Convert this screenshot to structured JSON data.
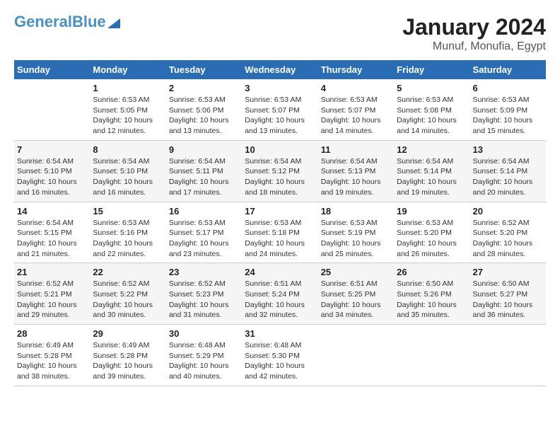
{
  "logo": {
    "part1": "General",
    "part2": "Blue"
  },
  "title": "January 2024",
  "subtitle": "Munuf, Monufia, Egypt",
  "days_of_week": [
    "Sunday",
    "Monday",
    "Tuesday",
    "Wednesday",
    "Thursday",
    "Friday",
    "Saturday"
  ],
  "weeks": [
    [
      {
        "num": "",
        "sunrise": "",
        "sunset": "",
        "daylight": ""
      },
      {
        "num": "1",
        "sunrise": "Sunrise: 6:53 AM",
        "sunset": "Sunset: 5:05 PM",
        "daylight": "Daylight: 10 hours and 12 minutes."
      },
      {
        "num": "2",
        "sunrise": "Sunrise: 6:53 AM",
        "sunset": "Sunset: 5:06 PM",
        "daylight": "Daylight: 10 hours and 13 minutes."
      },
      {
        "num": "3",
        "sunrise": "Sunrise: 6:53 AM",
        "sunset": "Sunset: 5:07 PM",
        "daylight": "Daylight: 10 hours and 13 minutes."
      },
      {
        "num": "4",
        "sunrise": "Sunrise: 6:53 AM",
        "sunset": "Sunset: 5:07 PM",
        "daylight": "Daylight: 10 hours and 14 minutes."
      },
      {
        "num": "5",
        "sunrise": "Sunrise: 6:53 AM",
        "sunset": "Sunset: 5:08 PM",
        "daylight": "Daylight: 10 hours and 14 minutes."
      },
      {
        "num": "6",
        "sunrise": "Sunrise: 6:53 AM",
        "sunset": "Sunset: 5:09 PM",
        "daylight": "Daylight: 10 hours and 15 minutes."
      }
    ],
    [
      {
        "num": "7",
        "sunrise": "Sunrise: 6:54 AM",
        "sunset": "Sunset: 5:10 PM",
        "daylight": "Daylight: 10 hours and 16 minutes."
      },
      {
        "num": "8",
        "sunrise": "Sunrise: 6:54 AM",
        "sunset": "Sunset: 5:10 PM",
        "daylight": "Daylight: 10 hours and 16 minutes."
      },
      {
        "num": "9",
        "sunrise": "Sunrise: 6:54 AM",
        "sunset": "Sunset: 5:11 PM",
        "daylight": "Daylight: 10 hours and 17 minutes."
      },
      {
        "num": "10",
        "sunrise": "Sunrise: 6:54 AM",
        "sunset": "Sunset: 5:12 PM",
        "daylight": "Daylight: 10 hours and 18 minutes."
      },
      {
        "num": "11",
        "sunrise": "Sunrise: 6:54 AM",
        "sunset": "Sunset: 5:13 PM",
        "daylight": "Daylight: 10 hours and 19 minutes."
      },
      {
        "num": "12",
        "sunrise": "Sunrise: 6:54 AM",
        "sunset": "Sunset: 5:14 PM",
        "daylight": "Daylight: 10 hours and 19 minutes."
      },
      {
        "num": "13",
        "sunrise": "Sunrise: 6:54 AM",
        "sunset": "Sunset: 5:14 PM",
        "daylight": "Daylight: 10 hours and 20 minutes."
      }
    ],
    [
      {
        "num": "14",
        "sunrise": "Sunrise: 6:54 AM",
        "sunset": "Sunset: 5:15 PM",
        "daylight": "Daylight: 10 hours and 21 minutes."
      },
      {
        "num": "15",
        "sunrise": "Sunrise: 6:53 AM",
        "sunset": "Sunset: 5:16 PM",
        "daylight": "Daylight: 10 hours and 22 minutes."
      },
      {
        "num": "16",
        "sunrise": "Sunrise: 6:53 AM",
        "sunset": "Sunset: 5:17 PM",
        "daylight": "Daylight: 10 hours and 23 minutes."
      },
      {
        "num": "17",
        "sunrise": "Sunrise: 6:53 AM",
        "sunset": "Sunset: 5:18 PM",
        "daylight": "Daylight: 10 hours and 24 minutes."
      },
      {
        "num": "18",
        "sunrise": "Sunrise: 6:53 AM",
        "sunset": "Sunset: 5:19 PM",
        "daylight": "Daylight: 10 hours and 25 minutes."
      },
      {
        "num": "19",
        "sunrise": "Sunrise: 6:53 AM",
        "sunset": "Sunset: 5:20 PM",
        "daylight": "Daylight: 10 hours and 26 minutes."
      },
      {
        "num": "20",
        "sunrise": "Sunrise: 6:52 AM",
        "sunset": "Sunset: 5:20 PM",
        "daylight": "Daylight: 10 hours and 28 minutes."
      }
    ],
    [
      {
        "num": "21",
        "sunrise": "Sunrise: 6:52 AM",
        "sunset": "Sunset: 5:21 PM",
        "daylight": "Daylight: 10 hours and 29 minutes."
      },
      {
        "num": "22",
        "sunrise": "Sunrise: 6:52 AM",
        "sunset": "Sunset: 5:22 PM",
        "daylight": "Daylight: 10 hours and 30 minutes."
      },
      {
        "num": "23",
        "sunrise": "Sunrise: 6:52 AM",
        "sunset": "Sunset: 5:23 PM",
        "daylight": "Daylight: 10 hours and 31 minutes."
      },
      {
        "num": "24",
        "sunrise": "Sunrise: 6:51 AM",
        "sunset": "Sunset: 5:24 PM",
        "daylight": "Daylight: 10 hours and 32 minutes."
      },
      {
        "num": "25",
        "sunrise": "Sunrise: 6:51 AM",
        "sunset": "Sunset: 5:25 PM",
        "daylight": "Daylight: 10 hours and 34 minutes."
      },
      {
        "num": "26",
        "sunrise": "Sunrise: 6:50 AM",
        "sunset": "Sunset: 5:26 PM",
        "daylight": "Daylight: 10 hours and 35 minutes."
      },
      {
        "num": "27",
        "sunrise": "Sunrise: 6:50 AM",
        "sunset": "Sunset: 5:27 PM",
        "daylight": "Daylight: 10 hours and 36 minutes."
      }
    ],
    [
      {
        "num": "28",
        "sunrise": "Sunrise: 6:49 AM",
        "sunset": "Sunset: 5:28 PM",
        "daylight": "Daylight: 10 hours and 38 minutes."
      },
      {
        "num": "29",
        "sunrise": "Sunrise: 6:49 AM",
        "sunset": "Sunset: 5:28 PM",
        "daylight": "Daylight: 10 hours and 39 minutes."
      },
      {
        "num": "30",
        "sunrise": "Sunrise: 6:48 AM",
        "sunset": "Sunset: 5:29 PM",
        "daylight": "Daylight: 10 hours and 40 minutes."
      },
      {
        "num": "31",
        "sunrise": "Sunrise: 6:48 AM",
        "sunset": "Sunset: 5:30 PM",
        "daylight": "Daylight: 10 hours and 42 minutes."
      },
      {
        "num": "",
        "sunrise": "",
        "sunset": "",
        "daylight": ""
      },
      {
        "num": "",
        "sunrise": "",
        "sunset": "",
        "daylight": ""
      },
      {
        "num": "",
        "sunrise": "",
        "sunset": "",
        "daylight": ""
      }
    ]
  ]
}
